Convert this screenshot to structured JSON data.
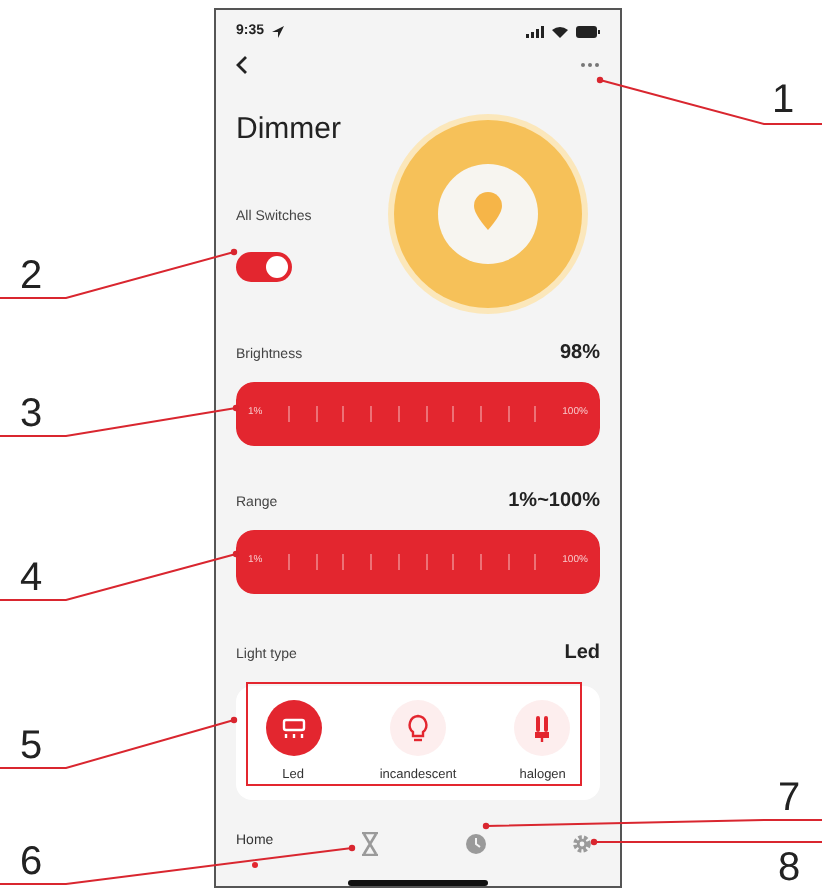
{
  "status_bar": {
    "time": "9:35"
  },
  "title": "Dimmer",
  "all_switches": {
    "label": "All Switches",
    "on": true
  },
  "sliders": [
    {
      "label": "Brightness",
      "reading": "98%",
      "min_label": "1%",
      "max_label": "100%"
    },
    {
      "label": "Range",
      "reading": "1%~100%",
      "min_label": "1%",
      "max_label": "100%"
    }
  ],
  "light_type": {
    "label": "Light type",
    "value": "Led",
    "options": [
      {
        "label": "Led",
        "selected": true
      },
      {
        "label": "incandescent",
        "selected": false
      },
      {
        "label": "halogen",
        "selected": false
      }
    ]
  },
  "tab_bar": [
    {
      "kind": "text",
      "label": "Home",
      "selected": true
    },
    {
      "kind": "icon",
      "selected": false
    },
    {
      "kind": "icon",
      "selected": false
    },
    {
      "kind": "icon",
      "selected": false
    }
  ],
  "callouts": [
    {
      "number": "1"
    },
    {
      "number": "2"
    },
    {
      "number": "3"
    },
    {
      "number": "4"
    },
    {
      "number": "5"
    },
    {
      "number": "7"
    },
    {
      "number": "6"
    },
    {
      "number": "8"
    }
  ]
}
